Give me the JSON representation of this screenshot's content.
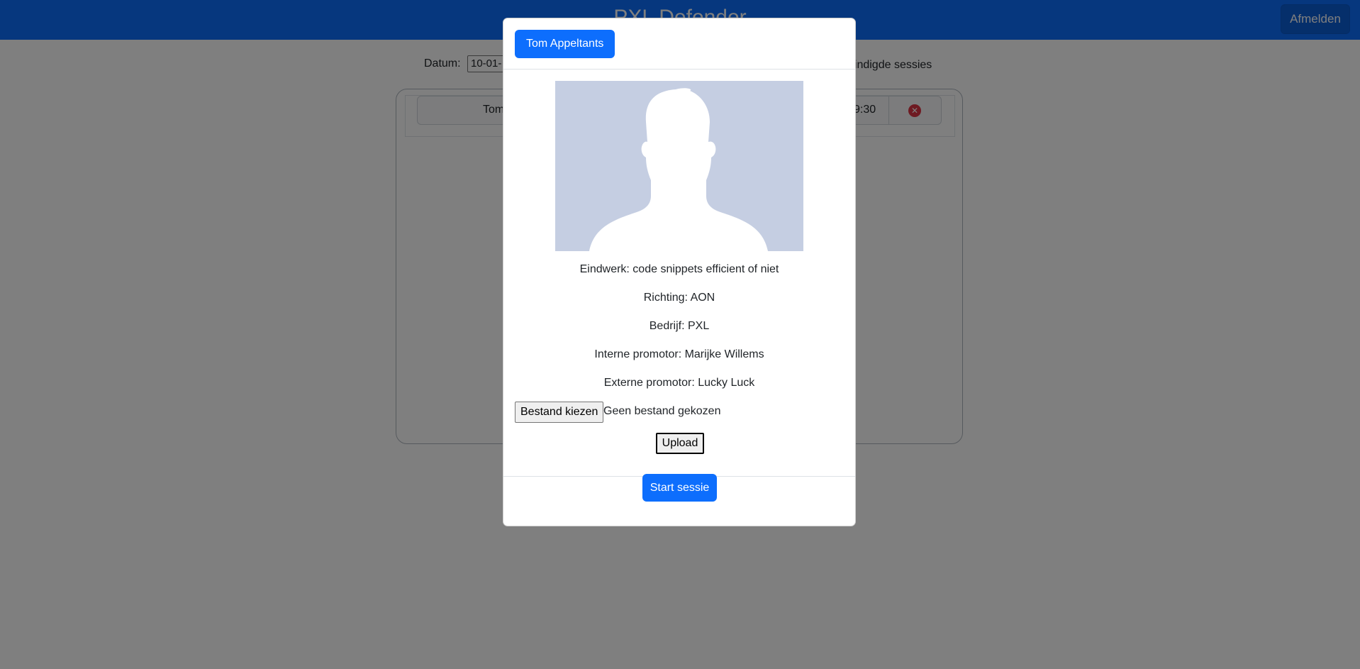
{
  "navbar": {
    "title": "PXL Defender",
    "logout_label": "Afmelden"
  },
  "filters": {
    "date_label": "Datum:",
    "date_value": "10-01-",
    "ended_label": "eindigde sessies"
  },
  "session_row": {
    "name": "Tom",
    "time": "9:30",
    "delete_glyph": "✕"
  },
  "modal": {
    "student_name": "Tom Appeltants",
    "avatar_icon": "person-silhouette-icon",
    "info": {
      "eindwerk": "Eindwerk: code snippets efficient of niet",
      "richting": "Richting: AON",
      "bedrijf": "Bedrijf: PXL",
      "interne_promotor": "Interne promotor: Marijke Willems",
      "externe_promotor": "Externe promotor: Lucky Luck"
    },
    "file_button_label": "Bestand kiezen",
    "file_status": "Geen bestand gekozen",
    "upload_label": "Upload",
    "start_label": "Start sessie"
  },
  "colors": {
    "primary": "#0d6efd",
    "avatar_bg": "#c5cee2",
    "danger": "#dc3545"
  }
}
